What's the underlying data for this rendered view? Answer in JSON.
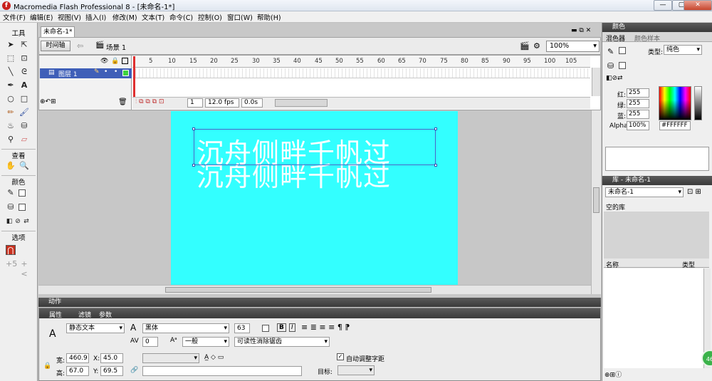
{
  "window": {
    "title": "Macromedia Flash Professional 8 - [未命名-1*]",
    "min": "—",
    "max": "▢",
    "close": "✕"
  },
  "menu": [
    "文件(F)",
    "编辑(E)",
    "视图(V)",
    "插入(I)",
    "修改(M)",
    "文本(T)",
    "命令(C)",
    "控制(O)",
    "窗口(W)",
    "帮助(H)"
  ],
  "toolbox": {
    "tools_label": "工具",
    "view_label": "查看",
    "color_label": "颜色",
    "options_label": "选项"
  },
  "document": {
    "tab": "未命名-1*",
    "timeline_button": "时间轴",
    "scene": "场景 1",
    "zoom": "100%"
  },
  "timeline": {
    "ruler": [
      "5",
      "10",
      "15",
      "20",
      "25",
      "30",
      "35",
      "40",
      "45",
      "50",
      "55",
      "60",
      "65",
      "70",
      "75",
      "80",
      "85",
      "90",
      "95",
      "100",
      "105"
    ],
    "layer": "图层 1",
    "frame": "1",
    "fps": "12.0 fps",
    "time": "0.0s"
  },
  "stage": {
    "text": "沉舟侧畔千帆过",
    "background": "#33ffff"
  },
  "actions_panel": {
    "title": "动作"
  },
  "properties": {
    "tabs": [
      "属性",
      "滤镜",
      "参数"
    ],
    "text_type": "静态文本",
    "font": "黑体",
    "font_size": "63",
    "tracking": "0",
    "char_position": "一般",
    "render": "可读性消除锯齿",
    "width_label": "宽:",
    "width": "460.9",
    "height_label": "高:",
    "height": "67.0",
    "x_label": "X:",
    "x": "45.0",
    "y_label": "Y:",
    "y": "69.5",
    "auto_kern": "自动调整字距",
    "target_label": "目标:"
  },
  "color_panel": {
    "title": "颜色",
    "tabs": [
      "混色器",
      "颜色样本"
    ],
    "type_label": "类型:",
    "type": "纯色",
    "red_label": "红:",
    "red": "255",
    "green_label": "绿:",
    "green": "255",
    "blue_label": "蓝:",
    "blue": "255",
    "alpha_label": "Alpha:",
    "alpha": "100%",
    "hex": "#FFFFFF"
  },
  "library_panel": {
    "title": "库 - 未命名-1",
    "doc": "未命名-1",
    "empty": "空的库",
    "col_name": "名称",
    "col_type": "类型"
  },
  "badge": "46"
}
